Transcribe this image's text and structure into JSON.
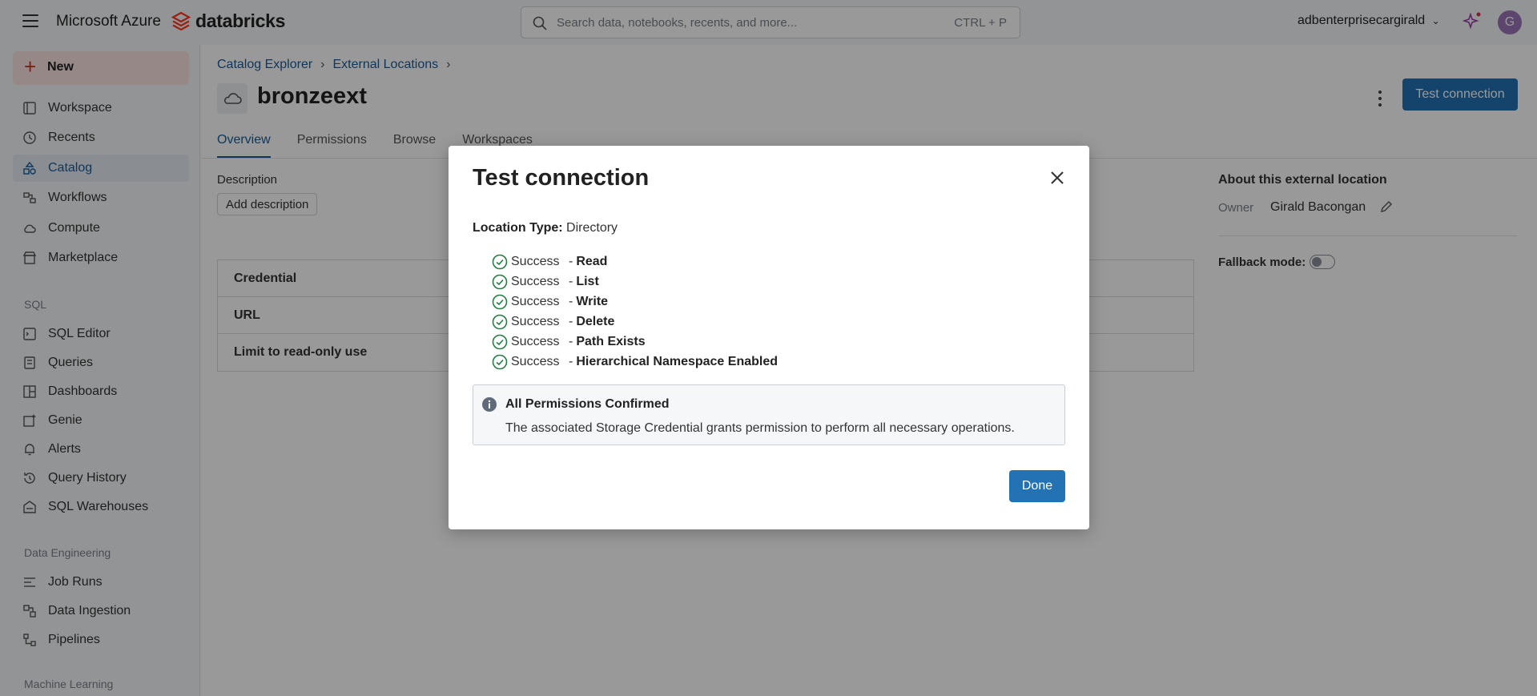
{
  "topbar": {
    "azure": "Microsoft Azure",
    "brand": "databricks",
    "search_placeholder": "Search data, notebooks, recents, and more...",
    "search_shortcut": "CTRL + P",
    "user": "adbenterprisecargirald",
    "avatar_initial": "G"
  },
  "sidebar": {
    "new_label": "New",
    "items": [
      {
        "label": "Workspace",
        "icon": "workspace-icon"
      },
      {
        "label": "Recents",
        "icon": "clock-icon"
      },
      {
        "label": "Catalog",
        "icon": "catalog-icon"
      },
      {
        "label": "Workflows",
        "icon": "workflows-icon"
      },
      {
        "label": "Compute",
        "icon": "cloud-icon"
      },
      {
        "label": "Marketplace",
        "icon": "store-icon"
      }
    ],
    "sql_title": "SQL",
    "sql_items": [
      {
        "label": "SQL Editor",
        "icon": "sql-editor-icon"
      },
      {
        "label": "Queries",
        "icon": "queries-icon"
      },
      {
        "label": "Dashboards",
        "icon": "dashboards-icon"
      },
      {
        "label": "Genie",
        "icon": "genie-icon"
      },
      {
        "label": "Alerts",
        "icon": "bell-icon"
      },
      {
        "label": "Query History",
        "icon": "history-icon"
      },
      {
        "label": "SQL Warehouses",
        "icon": "warehouse-icon"
      }
    ],
    "de_title": "Data Engineering",
    "de_items": [
      {
        "label": "Job Runs",
        "icon": "job-runs-icon"
      },
      {
        "label": "Data Ingestion",
        "icon": "ingestion-icon"
      },
      {
        "label": "Pipelines",
        "icon": "pipelines-icon"
      }
    ],
    "ml_title": "Machine Learning"
  },
  "main": {
    "breadcrumb": [
      "Catalog Explorer",
      "External Locations"
    ],
    "title": "bronzeext",
    "test_button": "Test connection",
    "tabs": [
      "Overview",
      "Permissions",
      "Browse",
      "Workspaces"
    ],
    "description_label": "Description",
    "add_description": "Add description",
    "properties": [
      "Credential",
      "URL",
      "Limit to read-only use"
    ],
    "about_title": "About this external location",
    "owner_label": "Owner",
    "owner_value": "Girald Bacongan",
    "fallback_label": "Fallback mode:"
  },
  "modal": {
    "title": "Test connection",
    "location_type_label": "Location Type:",
    "location_type_value": "Directory",
    "checks": [
      {
        "status": "Success",
        "name": "Read"
      },
      {
        "status": "Success",
        "name": "List"
      },
      {
        "status": "Success",
        "name": "Write"
      },
      {
        "status": "Success",
        "name": "Delete"
      },
      {
        "status": "Success",
        "name": "Path Exists"
      },
      {
        "status": "Success",
        "name": "Hierarchical Namespace Enabled"
      }
    ],
    "info_title": "All Permissions Confirmed",
    "info_body": "The associated Storage Credential grants permission to perform all necessary operations.",
    "done": "Done"
  },
  "colors": {
    "primary": "#2272b4",
    "success": "#277c43",
    "brand_red": "#ff3621"
  }
}
